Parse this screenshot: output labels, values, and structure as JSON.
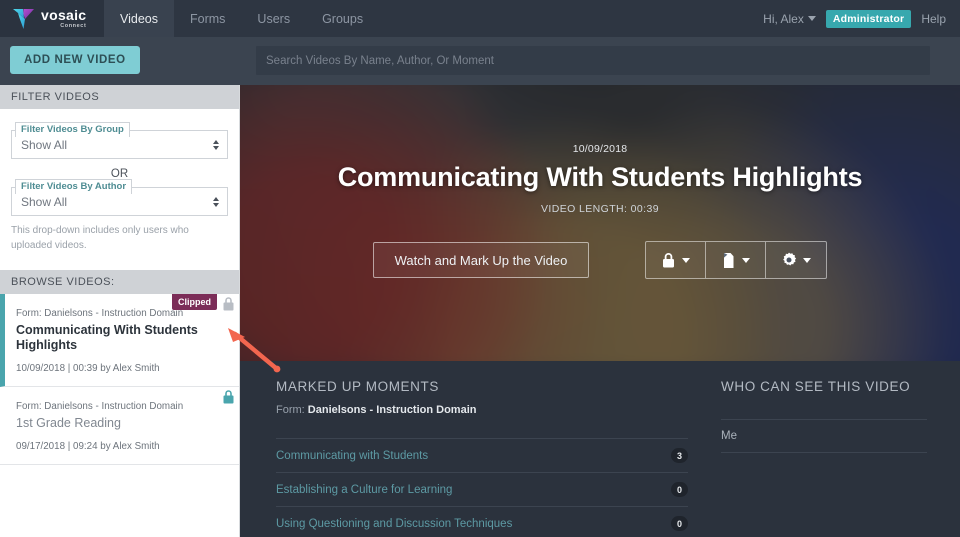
{
  "brand": {
    "name": "vosaic",
    "tagline": "Connect",
    "logo_purple": "#8b3fa8",
    "logo_teal": "#3fc4d6"
  },
  "topnav": {
    "tabs": [
      {
        "label": "Videos",
        "active": true
      },
      {
        "label": "Forms",
        "active": false
      },
      {
        "label": "Users",
        "active": false
      },
      {
        "label": "Groups",
        "active": false
      }
    ],
    "greeting": "Hi, Alex",
    "role_badge": "Administrator",
    "role_badge_color": "#37a8ae",
    "help": "Help"
  },
  "actionbar": {
    "add_video_label": "ADD NEW VIDEO",
    "add_video_color": "#7fcdd4",
    "search_placeholder": "Search Videos By Name, Author, Or Moment",
    "search_value": ""
  },
  "sidebar": {
    "filter_header": "FILTER VIDEOS",
    "group_filter_label": "Filter Videos By Group",
    "group_filter_value": "Show All",
    "or_text": "OR",
    "author_filter_label": "Filter Videos By Author",
    "author_filter_value": "Show All",
    "hint": "This drop-down includes only users who uploaded videos.",
    "browse_header": "BROWSE VIDEOS:",
    "videos": [
      {
        "form": "Form: Danielsons - Instruction Domain",
        "title": "Communicating With Students Highlights",
        "meta": "10/09/2018 | 00:39 by Alex Smith",
        "badge": "Clipped",
        "badge_color": "#7c2d58",
        "selected": true,
        "lock": "lock-icon"
      },
      {
        "form": "Form: Danielsons - Instruction Domain",
        "title": "1st Grade Reading",
        "meta": "09/17/2018 | 09:24 by Alex Smith",
        "badge": "",
        "selected": false,
        "lock": "lock-icon"
      }
    ]
  },
  "hero": {
    "date": "10/09/2018",
    "title": "Communicating With Students Highlights",
    "length_label": "VIDEO LENGTH:",
    "length_value": "00:39",
    "watch_label": "Watch and Mark Up the Video",
    "buttons": [
      {
        "icon": "lock-icon"
      },
      {
        "icon": "file-icon"
      },
      {
        "icon": "gear-icon"
      }
    ]
  },
  "moments": {
    "header": "MARKED UP MOMENTS",
    "form_prefix": "Form:",
    "form_name": "Danielsons - Instruction Domain",
    "rows": [
      {
        "label": "Communicating with Students",
        "count": "3"
      },
      {
        "label": "Establishing a Culture for Learning",
        "count": "0"
      },
      {
        "label": "Using Questioning and Discussion Techniques",
        "count": "0"
      }
    ]
  },
  "visibility": {
    "header": "WHO CAN SEE THIS VIDEO",
    "rows": [
      "Me"
    ]
  },
  "annotation": {
    "arrow_color": "#f2664f",
    "points_to": "lock-icon"
  }
}
